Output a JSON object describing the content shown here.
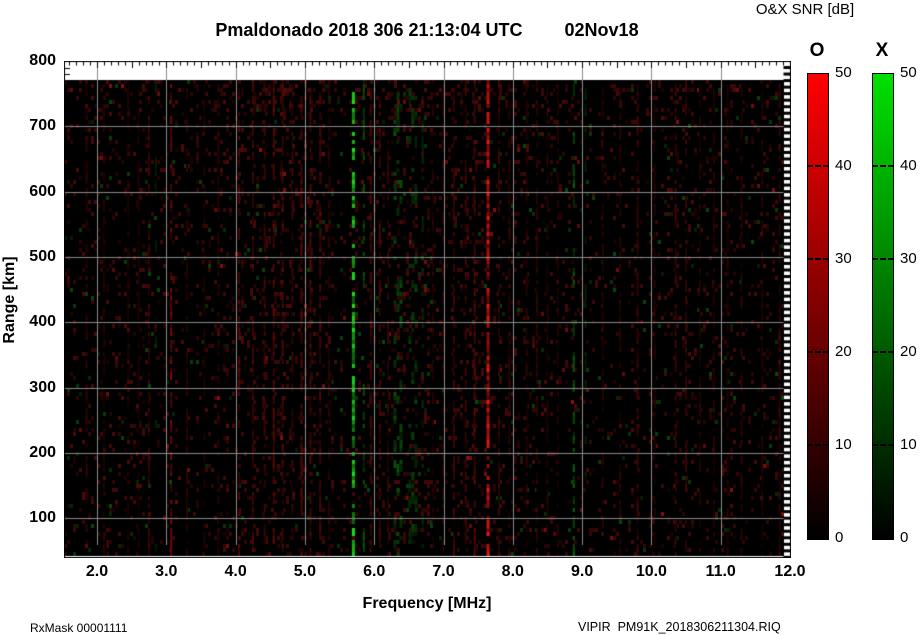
{
  "header": {
    "title": "Pmaldonado 2018 306 21:13:04 UTC",
    "date": "02Nov18",
    "colorbar_title": "O&X SNR [dB]"
  },
  "footer": {
    "left": "RxMask 00001111",
    "right": "VIPIR  PM91K_2018306211304.RIQ"
  },
  "chart_data": {
    "type": "heatmap",
    "title": "Pmaldonado 2018 306 21:13:04 UTC",
    "subtitle": "02Nov18",
    "xlabel": "Frequency [MHz]",
    "ylabel": "Range [km]",
    "xlim": [
      1.52,
      12.0
    ],
    "ylim": [
      40,
      800
    ],
    "grid": true,
    "background": "#000000",
    "gridline_color": "#8a8a8a",
    "x_tick_values": [
      2,
      3,
      4,
      5,
      6,
      7,
      8,
      9,
      10,
      11,
      12
    ],
    "x_tick_labels": [
      "2.0",
      "3.0",
      "4.0",
      "5.0",
      "6.0",
      "7.0",
      "8.0",
      "9.0",
      "10.0",
      "11.0",
      "12.0"
    ],
    "y_tick_values": [
      100,
      200,
      300,
      400,
      500,
      600,
      700,
      800
    ],
    "y_tick_labels": [
      "100",
      "200",
      "300",
      "400",
      "500",
      "600",
      "700",
      "800"
    ],
    "colorbars": [
      {
        "name": "O",
        "color": "#ff0000",
        "min": 0,
        "max": 50,
        "ticks": [
          50,
          40,
          30,
          20,
          10,
          0
        ]
      },
      {
        "name": "X",
        "color": "#00e000",
        "min": 0,
        "max": 50,
        "ticks": [
          50,
          40,
          30,
          20,
          10,
          0
        ]
      }
    ],
    "data_range_km": [
      40,
      766
    ],
    "noise": {
      "red_density": 0.1,
      "green_density": 0.012,
      "bands": [
        {
          "from": 4.2,
          "to": 5.4,
          "boost": 1.5
        },
        {
          "from": 5.9,
          "to": 8.1,
          "boost": 1.45
        },
        {
          "from": 2.9,
          "to": 3.3,
          "boost": 1.2
        },
        {
          "from": 10.2,
          "to": 10.7,
          "boost": 1.2
        }
      ]
    },
    "streaks": [
      {
        "f": 1.85,
        "mode": "O",
        "i": 0.22
      },
      {
        "f": 2.1,
        "mode": "O",
        "i": 0.18
      },
      {
        "f": 2.45,
        "mode": "O",
        "i": 0.15
      },
      {
        "f": 2.6,
        "mode": "O",
        "i": 0.15
      },
      {
        "f": 2.75,
        "mode": "O",
        "i": 0.28
      },
      {
        "f": 2.85,
        "mode": "X",
        "i": 0.14,
        "d": 0.2
      },
      {
        "f": 3.07,
        "mode": "O",
        "i": 0.5
      },
      {
        "f": 3.3,
        "mode": "O",
        "i": 0.2
      },
      {
        "f": 3.55,
        "mode": "O",
        "i": 0.15
      },
      {
        "f": 3.75,
        "mode": "O",
        "i": 0.18
      },
      {
        "f": 4.05,
        "mode": "O",
        "i": 0.38
      },
      {
        "f": 4.25,
        "mode": "O",
        "i": 0.33
      },
      {
        "f": 4.42,
        "mode": "O",
        "i": 0.3
      },
      {
        "f": 4.55,
        "mode": "O",
        "i": 0.42
      },
      {
        "f": 4.68,
        "mode": "O",
        "i": 0.4
      },
      {
        "f": 4.82,
        "mode": "O",
        "i": 0.3
      },
      {
        "f": 4.95,
        "mode": "O",
        "i": 0.42
      },
      {
        "f": 5.08,
        "mode": "O",
        "i": 0.38
      },
      {
        "f": 5.22,
        "mode": "O",
        "i": 0.33
      },
      {
        "f": 5.35,
        "mode": "O",
        "i": 0.22
      },
      {
        "f": 5.7,
        "mode": "X",
        "i": 0.92,
        "w": 3,
        "d": 0.6
      },
      {
        "f": 5.85,
        "mode": "X",
        "i": 0.35,
        "d": 0.3
      },
      {
        "f": 5.95,
        "mode": "O",
        "i": 0.35
      },
      {
        "f": 6.08,
        "mode": "O",
        "i": 0.33
      },
      {
        "f": 6.2,
        "mode": "O",
        "i": 0.25
      },
      {
        "f": 6.35,
        "mode": "X",
        "i": 0.32,
        "w": 10,
        "d": 0.15
      },
      {
        "f": 6.55,
        "mode": "X",
        "i": 0.26,
        "w": 8,
        "d": 0.13
      },
      {
        "f": 6.7,
        "mode": "X",
        "i": 0.2,
        "d": 0.15
      },
      {
        "f": 6.85,
        "mode": "O",
        "i": 0.2
      },
      {
        "f": 7.0,
        "mode": "O",
        "i": 0.22
      },
      {
        "f": 7.15,
        "mode": "O",
        "i": 0.3
      },
      {
        "f": 7.32,
        "mode": "O",
        "i": 0.3
      },
      {
        "f": 7.45,
        "mode": "O",
        "i": 0.4
      },
      {
        "f": 7.65,
        "mode": "O",
        "i": 0.95,
        "w": 4,
        "d": 0.7
      },
      {
        "f": 7.8,
        "mode": "O",
        "i": 0.28
      },
      {
        "f": 7.95,
        "mode": "O",
        "i": 0.2
      },
      {
        "f": 8.2,
        "mode": "O",
        "i": 0.2
      },
      {
        "f": 8.35,
        "mode": "O",
        "i": 0.22
      },
      {
        "f": 8.5,
        "mode": "O",
        "i": 0.18
      },
      {
        "f": 8.65,
        "mode": "O",
        "i": 0.15
      },
      {
        "f": 8.88,
        "mode": "X",
        "i": 0.42,
        "d": 0.28
      },
      {
        "f": 9.05,
        "mode": "X",
        "i": 0.18,
        "d": 0.15
      },
      {
        "f": 9.3,
        "mode": "O",
        "i": 0.18
      },
      {
        "f": 9.55,
        "mode": "O",
        "i": 0.2
      },
      {
        "f": 9.8,
        "mode": "O",
        "i": 0.28
      },
      {
        "f": 10.05,
        "mode": "O",
        "i": 0.18
      },
      {
        "f": 10.35,
        "mode": "O",
        "i": 0.3
      },
      {
        "f": 10.5,
        "mode": "O",
        "i": 0.28
      },
      {
        "f": 10.7,
        "mode": "O",
        "i": 0.18
      },
      {
        "f": 10.9,
        "mode": "O",
        "i": 0.18
      },
      {
        "f": 11.1,
        "mode": "O",
        "i": 0.2
      },
      {
        "f": 11.3,
        "mode": "O",
        "i": 0.22
      },
      {
        "f": 11.6,
        "mode": "O",
        "i": 0.18
      },
      {
        "f": 11.85,
        "mode": "O",
        "i": 0.25
      }
    ]
  }
}
